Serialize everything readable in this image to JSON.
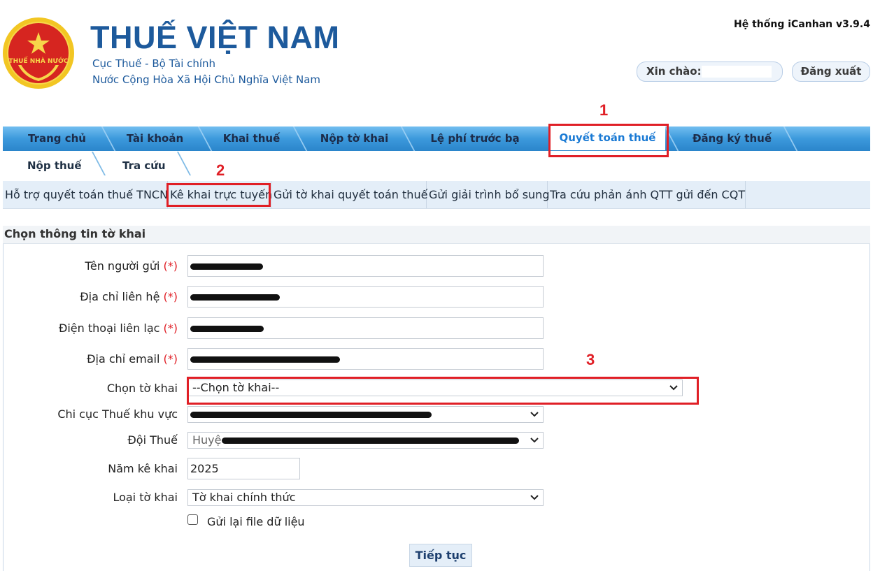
{
  "header": {
    "logo_text": "THUẾ NHÀ NƯỚC",
    "brand": "THUẾ VIỆT NAM",
    "subtitle_1": "Cục Thuế - Bộ Tài chính",
    "subtitle_2": "Nước Cộng Hòa Xã Hội Chủ Nghĩa Việt Nam",
    "system_version": "Hệ thống iCanhan v3.9.4",
    "greeting_label": "Xin chào:",
    "logout_label": "Đăng xuất"
  },
  "main_nav": {
    "items": [
      "Trang chủ",
      "Tài khoản",
      "Khai thuế",
      "Nộp tờ khai",
      "Lệ phí trước bạ",
      "Quyết toán thuế",
      "Đăng ký thuế"
    ],
    "active": "Quyết toán thuế"
  },
  "sub_nav": {
    "items": [
      "Nộp thuế",
      "Tra cứu"
    ]
  },
  "third_nav": {
    "items": [
      "Hỗ trợ quyết toán thuế TNCN",
      "Kê khai trực tuyến",
      "Gửi tờ khai quyết toán thuế",
      "Gửi giải trình bổ sung",
      "Tra cứu phản ánh QTT gửi đến CQT"
    ]
  },
  "annotations": [
    "1",
    "2",
    "3"
  ],
  "form": {
    "title": "Chọn thông tin tờ khai",
    "required_mark": "(*)",
    "fields": {
      "sender_name_label": "Tên người gửi",
      "address_label": "Địa chỉ liên hệ",
      "phone_label": "Điện thoại liên lạc",
      "email_label": "Địa chỉ email",
      "form_select_label": "Chọn tờ khai",
      "form_select_value": "--Chọn tờ khai--",
      "tax_dept_label": "Chi cục Thuế khu vực",
      "tax_team_label": "Đội Thuế",
      "tax_team_value_prefix": "Huyệ",
      "year_label": "Năm kê khai",
      "year_value": "2025",
      "type_label": "Loại tờ khai",
      "type_value": "Tờ khai chính thức",
      "resend_label": "Gửi lại file dữ liệu"
    },
    "continue_button": "Tiếp tục"
  },
  "colors": {
    "brand_blue": "#1d5a9c",
    "nav_blue": "#3c99dc",
    "active_tab_text": "#1a7ad4",
    "annotation_red": "#e01f26"
  }
}
